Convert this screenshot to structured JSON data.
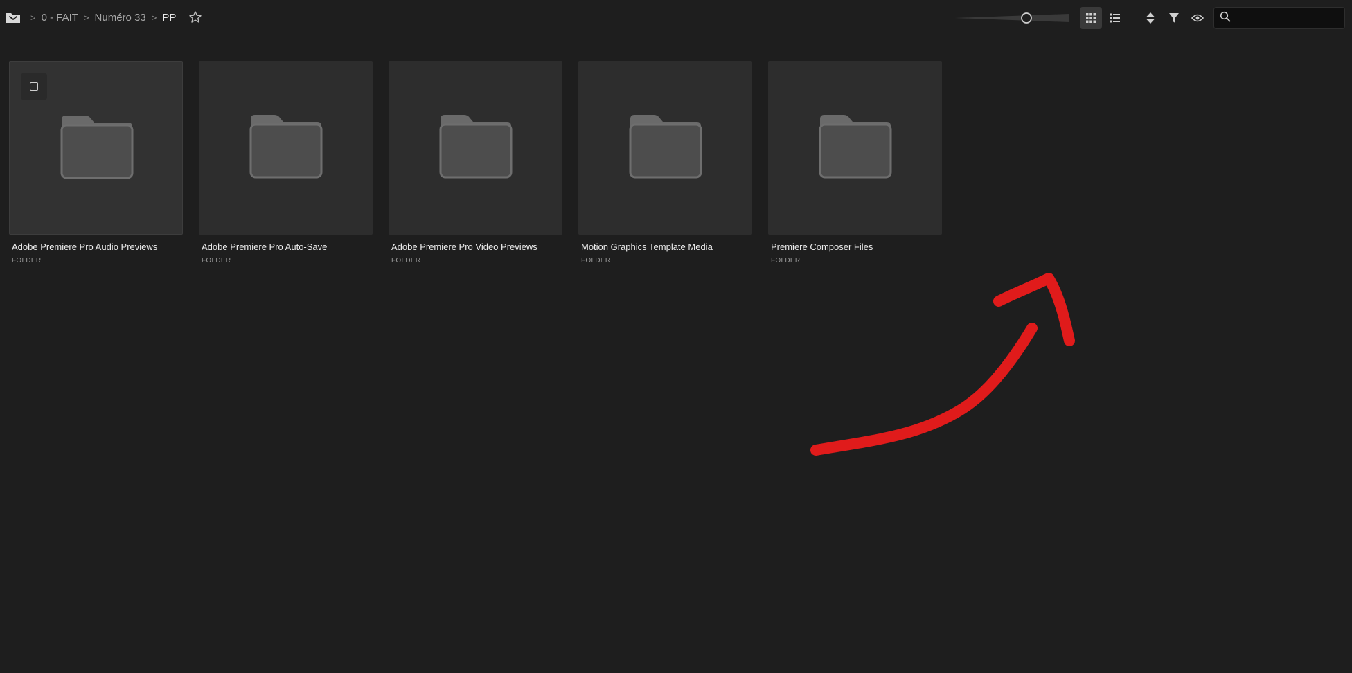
{
  "breadcrumb": {
    "root_icon": "folder-root-icon",
    "items": [
      {
        "label": "0 - FAIT"
      },
      {
        "label": "Numéro 33"
      },
      {
        "label": "PP"
      }
    ],
    "separator": ">"
  },
  "toolbar": {
    "thumbnail_size_icon": "thumbnail-size-slider",
    "grid_view_icon": "grid-view-icon",
    "list_view_icon": "list-view-icon",
    "sort_icon": "sort-icon",
    "filter_icon": "filter-icon",
    "view_options_icon": "eye-icon",
    "search": {
      "value": "",
      "placeholder": ""
    }
  },
  "folders": [
    {
      "name": "Adobe Premiere Pro Audio Previews",
      "kind": "FOLDER"
    },
    {
      "name": "Adobe Premiere Pro Auto-Save",
      "kind": "FOLDER"
    },
    {
      "name": "Adobe Premiere Pro Video Previews",
      "kind": "FOLDER"
    },
    {
      "name": "Motion Graphics Template Media",
      "kind": "FOLDER"
    },
    {
      "name": "Premiere Composer Files",
      "kind": "FOLDER"
    }
  ],
  "colors": {
    "background": "#1e1e1e",
    "card": "#2d2d2d",
    "annotation_arrow": "#e01b1b"
  }
}
